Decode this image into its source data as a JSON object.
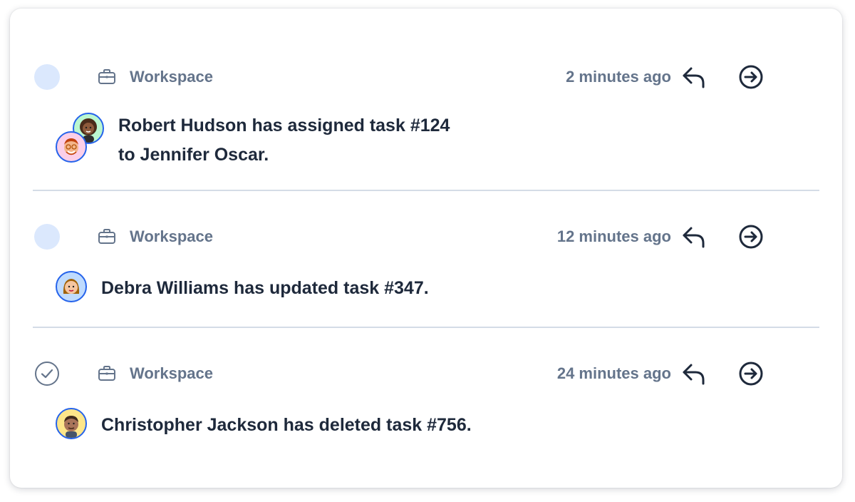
{
  "notifications": [
    {
      "status": "unread",
      "status_icon": "unread-dot",
      "workspace_icon": "briefcase-icon",
      "workspace_label": "Workspace",
      "time": "2 minutes ago",
      "reply_icon": "reply-icon",
      "open_icon": "arrow-right-circle-icon",
      "message_line1": "Robert Hudson has assigned task #124",
      "message_line2": "to Jennifer Oscar.",
      "avatars": [
        "robert-hudson-avatar",
        "jennifer-oscar-avatar"
      ]
    },
    {
      "status": "unread",
      "status_icon": "unread-dot",
      "workspace_icon": "briefcase-icon",
      "workspace_label": "Workspace",
      "time": "12 minutes ago",
      "reply_icon": "reply-icon",
      "open_icon": "arrow-right-circle-icon",
      "message": "Debra Williams has updated task #347.",
      "avatars": [
        "debra-williams-avatar"
      ]
    },
    {
      "status": "read",
      "status_icon": "check-circle-icon",
      "workspace_icon": "briefcase-icon",
      "workspace_label": "Workspace",
      "time": "24 minutes ago",
      "reply_icon": "reply-icon",
      "open_icon": "arrow-right-circle-icon",
      "message": "Christopher Jackson has deleted task #756.",
      "avatars": [
        "christopher-jackson-avatar"
      ]
    }
  ],
  "colors": {
    "muted_text": "#64748b",
    "primary_text": "#1e293b",
    "unread_dot": "#dbe8fd",
    "divider": "#d4dce6",
    "avatar_ring": "#2563eb"
  }
}
